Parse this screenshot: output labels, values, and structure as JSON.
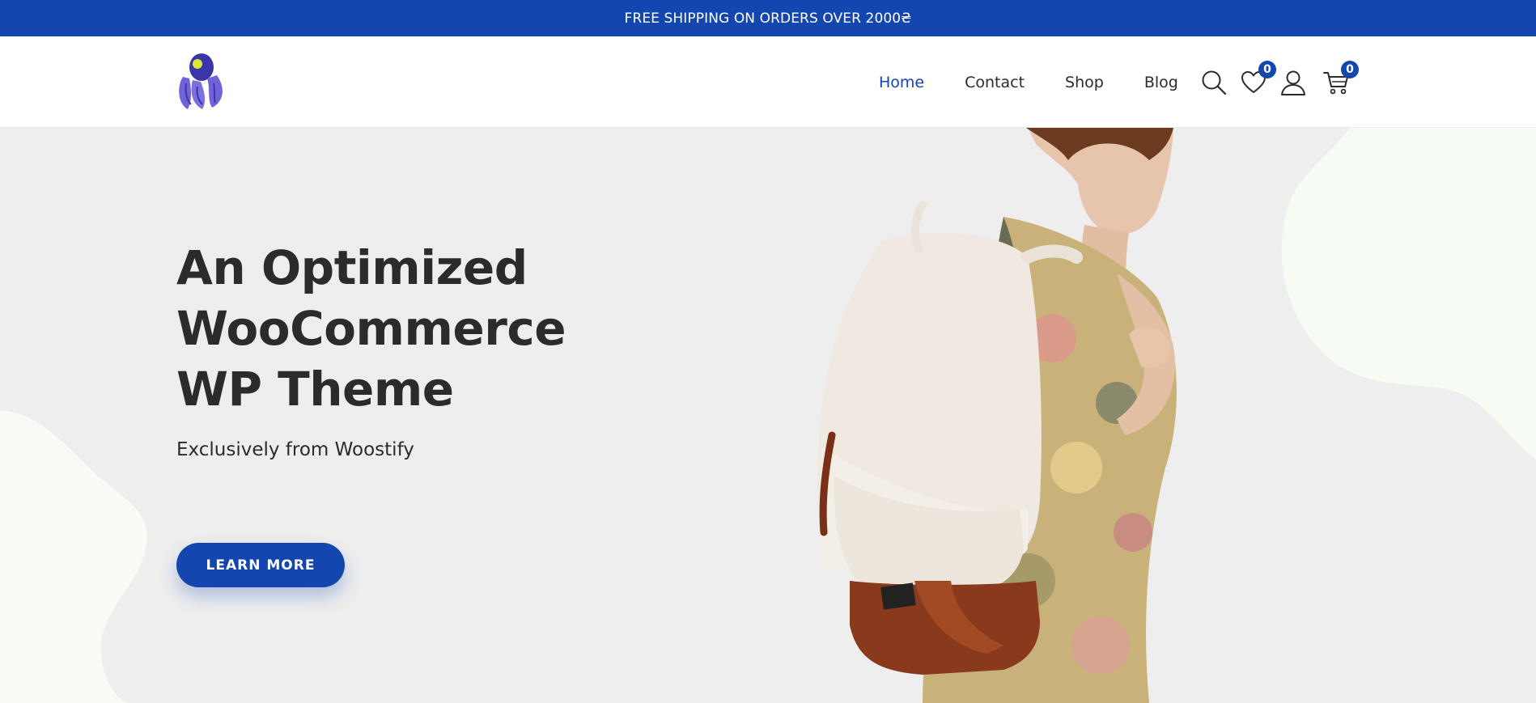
{
  "topbar": {
    "announcement": "FREE SHIPPING ON ORDERS OVER 2000₴"
  },
  "header": {
    "logo_icon": "woostify-rocket-logo",
    "nav": [
      {
        "label": "Home",
        "active": true
      },
      {
        "label": "Contact",
        "active": false
      },
      {
        "label": "Shop",
        "active": false
      },
      {
        "label": "Blog",
        "active": false
      }
    ],
    "icons": {
      "search": "search-icon",
      "wishlist": "heart-icon",
      "account": "user-icon",
      "cart": "cart-icon"
    },
    "wishlist_count": "0",
    "cart_count": "0"
  },
  "hero": {
    "title_lines": [
      "An Optimized",
      "WooCommerce",
      "WP Theme"
    ],
    "subtitle": "Exclusively from Woostify",
    "cta_label": "LEARN MORE",
    "image": "model-with-white-backpack"
  },
  "colors": {
    "brand": "#1346af",
    "text": "#2b2b2b",
    "hero_bg": "#eeeeee"
  }
}
